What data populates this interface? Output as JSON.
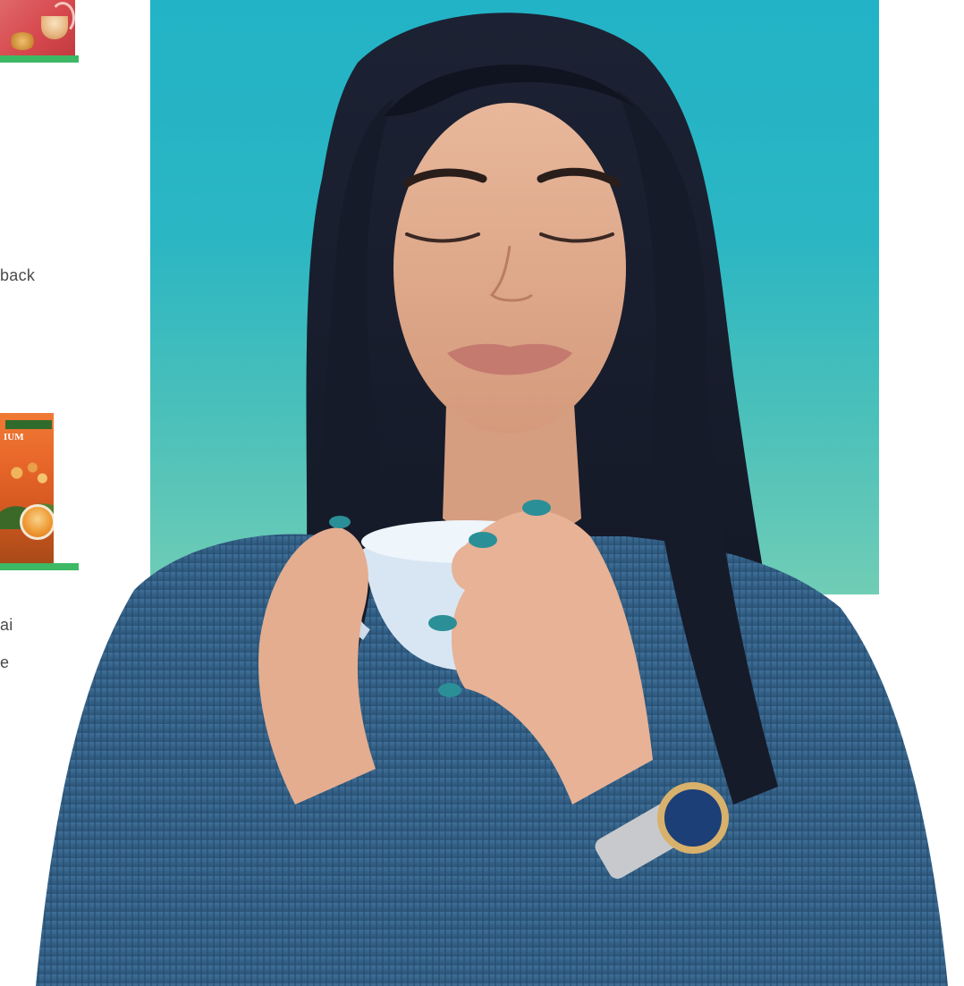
{
  "products": [
    {
      "name": "product-card-1",
      "accent_color": "#3db864",
      "description_fragment": "back"
    },
    {
      "name": "product-card-2",
      "package_text": "IUM",
      "accent_color": "#3db864",
      "description_fragments": [
        "ai",
        "e"
      ]
    }
  ],
  "hero": {
    "background_top": "#22b3c7",
    "background_bottom": "#70cdb6"
  }
}
